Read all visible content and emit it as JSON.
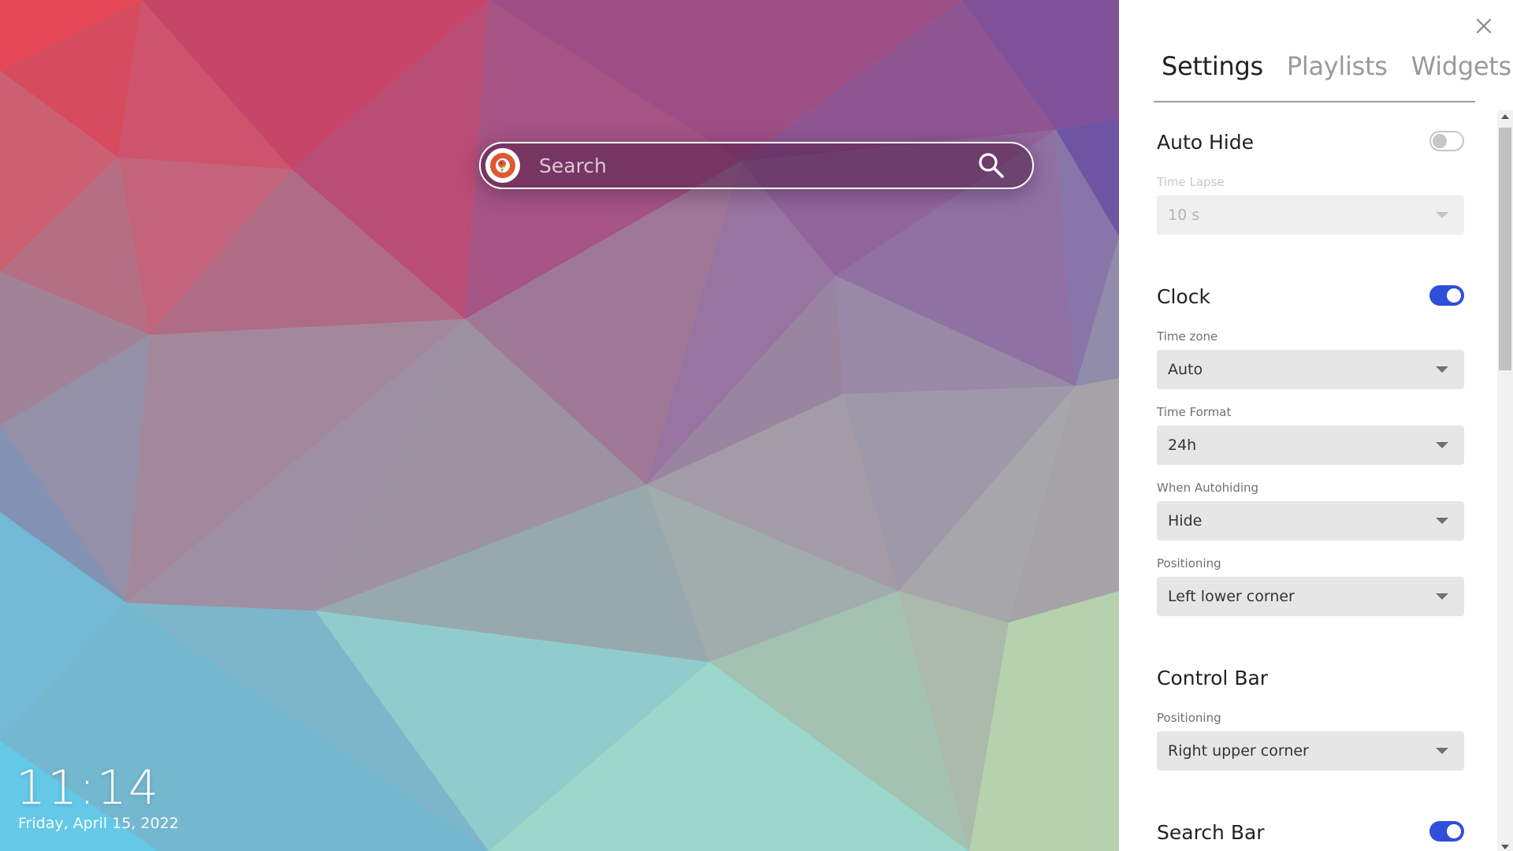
{
  "search": {
    "placeholder": "Search",
    "engine_icon": "duckduckgo-icon",
    "button_icon": "search-icon"
  },
  "clock": {
    "time": "11:14",
    "date": "Friday, April 15, 2022"
  },
  "panel": {
    "close_icon": "close-icon",
    "tabs": [
      {
        "label": "Settings",
        "active": true
      },
      {
        "label": "Playlists",
        "active": false
      },
      {
        "label": "Widgets",
        "active": false
      }
    ],
    "auto_hide": {
      "title": "Auto Hide",
      "enabled": false,
      "time_lapse_label": "Time Lapse",
      "time_lapse_value": "10 s"
    },
    "clock": {
      "title": "Clock",
      "enabled": true,
      "time_zone_label": "Time zone",
      "time_zone_value": "Auto",
      "time_format_label": "Time Format",
      "time_format_value": "24h",
      "when_autohiding_label": "When Autohiding",
      "when_autohiding_value": "Hide",
      "positioning_label": "Positioning",
      "positioning_value": "Left lower corner"
    },
    "control_bar": {
      "title": "Control Bar",
      "positioning_label": "Positioning",
      "positioning_value": "Right upper corner"
    },
    "search_bar": {
      "title": "Search Bar",
      "enabled": true
    }
  },
  "colors": {
    "toggle_on": "#2f4fd8",
    "toggle_off": "#c6c6c6",
    "select_bg": "#e6e6e6",
    "panel_bg": "#ffffff"
  }
}
